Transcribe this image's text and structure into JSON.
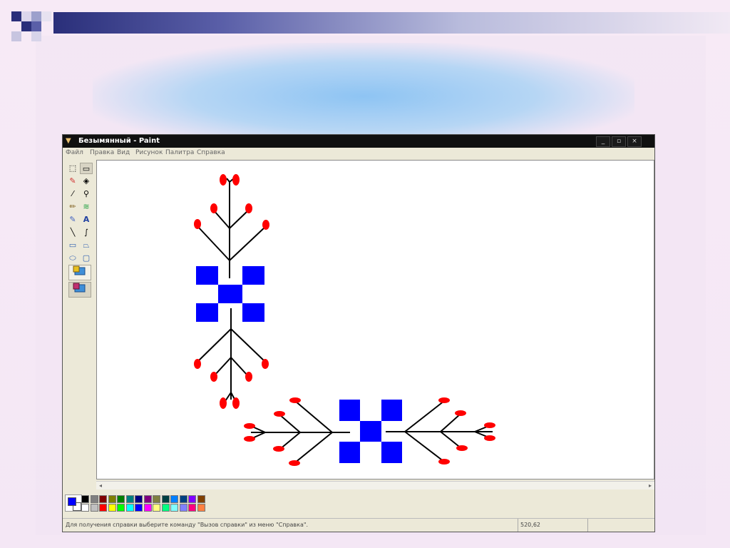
{
  "window": {
    "title": "Безымянный - Paint",
    "minimize": "_",
    "maximize": "▫",
    "close": "×"
  },
  "menu": [
    "Файл",
    "Правка",
    "Вид",
    "Рисунок",
    "Палитра",
    "Справка"
  ],
  "tools": [
    {
      "name": "free-select",
      "icon": "⬚"
    },
    {
      "name": "rect-select",
      "icon": "▭"
    },
    {
      "name": "eraser",
      "icon": "✎"
    },
    {
      "name": "fill",
      "icon": "◈"
    },
    {
      "name": "picker",
      "icon": "⁄"
    },
    {
      "name": "zoom",
      "icon": "⚲"
    },
    {
      "name": "pencil",
      "icon": "✏"
    },
    {
      "name": "brush",
      "icon": "≋"
    },
    {
      "name": "airbrush",
      "icon": "✎"
    },
    {
      "name": "text",
      "icon": "A"
    },
    {
      "name": "line",
      "icon": "╲"
    },
    {
      "name": "curve",
      "icon": "∫"
    },
    {
      "name": "rectangle",
      "icon": "▭"
    },
    {
      "name": "polygon",
      "icon": "⏢"
    },
    {
      "name": "ellipse",
      "icon": "⬭"
    },
    {
      "name": "rounded-rect",
      "icon": "▢"
    }
  ],
  "status": {
    "help_text": "Для получения справки выберите команду \"Вызов справки\" из меню \"Справка\".",
    "coords": "520,62"
  },
  "palette": {
    "foreground": "#0000ff",
    "background": "#ffffff",
    "row1": [
      "#000000",
      "#808080",
      "#800000",
      "#808000",
      "#008000",
      "#008080",
      "#000080",
      "#800080",
      "#808040",
      "#004040",
      "#0080ff",
      "#004080",
      "#8000ff",
      "#804000"
    ],
    "row2": [
      "#ffffff",
      "#c0c0c0",
      "#ff0000",
      "#ffff00",
      "#00ff00",
      "#00ffff",
      "#0000ff",
      "#ff00ff",
      "#ffff80",
      "#00ff80",
      "#80ffff",
      "#8080ff",
      "#ff0080",
      "#ff8040"
    ]
  },
  "drawing": {
    "block_color": "#0000ff",
    "berry_color": "#ff0000",
    "stem_color": "#000000"
  }
}
